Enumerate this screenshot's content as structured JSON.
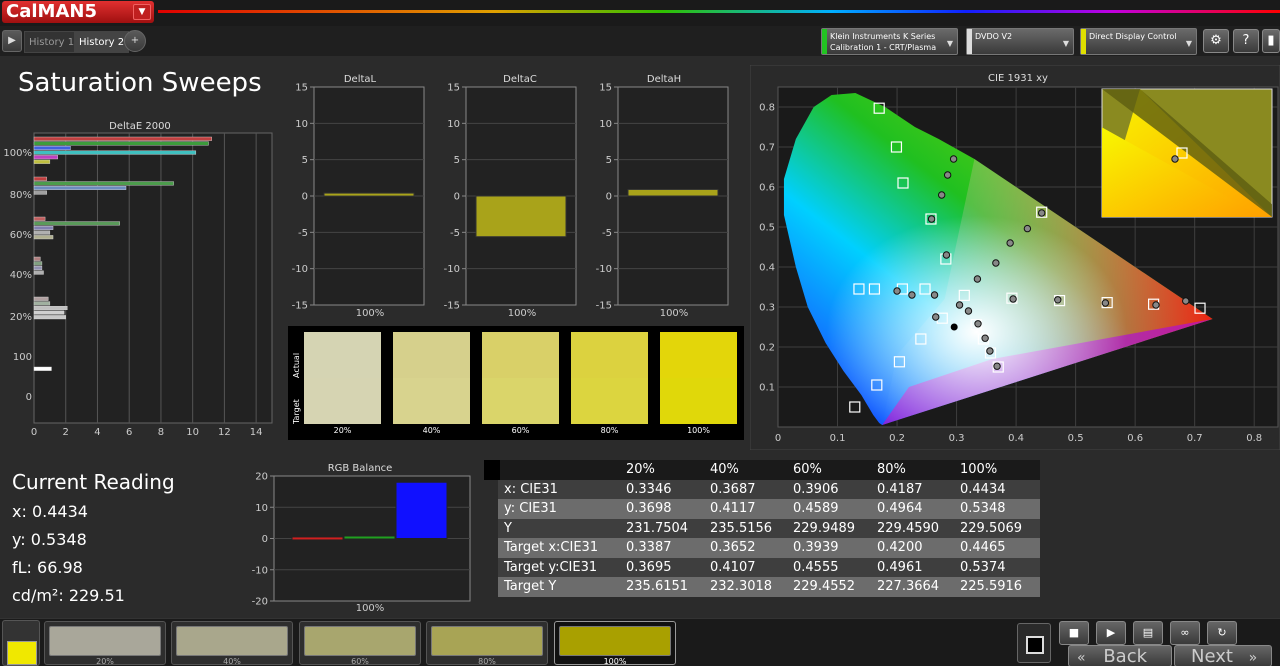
{
  "app": {
    "logo": "CalMAN",
    "logo_version": "5",
    "logo_menu_icon": "caret-down-icon"
  },
  "tabs": {
    "history1": "History 1",
    "history2": "History 2",
    "add_icon": "plus-icon",
    "play_icon": "play-icon"
  },
  "devices": [
    {
      "line1": "Klein Instruments K Series",
      "line2": "Calibration 1 - CRT/Plasma",
      "color": "#22c422"
    },
    {
      "line1": "DVDO V2",
      "line2": "",
      "color": "#dddddd"
    },
    {
      "line1": "Direct Display Control",
      "line2": "",
      "color": "#e0e000"
    }
  ],
  "toolbar_icons": [
    "gear-icon",
    "help-icon",
    "tool-icon"
  ],
  "page": {
    "title": "Saturation Sweeps"
  },
  "charts": {
    "deltae": {
      "title": "DeltaE 2000"
    },
    "deltal": {
      "title": "DeltaL",
      "category": "100%"
    },
    "deltac": {
      "title": "DeltaC",
      "category": "100%"
    },
    "deltah": {
      "title": "DeltaH",
      "category": "100%"
    },
    "cie": {
      "title": "CIE 1931 xy"
    },
    "rgb": {
      "title": "RGB Balance",
      "category": "100%"
    }
  },
  "chart_data": [
    {
      "type": "bar",
      "title": "DeltaE 2000",
      "orientation": "horizontal",
      "xlim": [
        0,
        15
      ],
      "x_ticks": [
        "0",
        "2",
        "4",
        "6",
        "8",
        "10",
        "12",
        "14"
      ],
      "y_ticks": [
        "100%",
        "80%",
        "60%",
        "40%",
        "20%",
        "100",
        "0"
      ],
      "groups": [
        {
          "name": "100%",
          "bars": [
            {
              "v": 11.2,
              "c": "#c04040"
            },
            {
              "v": 11.0,
              "c": "#3c9c3c"
            },
            {
              "v": 2.3,
              "c": "#4060e0"
            },
            {
              "v": 10.2,
              "c": "#40c0c0"
            },
            {
              "v": 1.5,
              "c": "#c040c0"
            },
            {
              "v": 1.0,
              "c": "#c0c040"
            }
          ]
        },
        {
          "name": "80%",
          "bars": [
            {
              "v": 0.8,
              "c": "#c04040"
            },
            {
              "v": 8.8,
              "c": "#4c9c4c"
            },
            {
              "v": 5.8,
              "c": "#6c8cc0"
            },
            {
              "v": 0.8,
              "c": "#a0a0a0"
            }
          ]
        },
        {
          "name": "60%",
          "bars": [
            {
              "v": 0.7,
              "c": "#c06060"
            },
            {
              "v": 5.4,
              "c": "#5a9a5a"
            },
            {
              "v": 1.2,
              "c": "#8080b0"
            },
            {
              "v": 1.0,
              "c": "#b0b0b0"
            },
            {
              "v": 1.2,
              "c": "#b0b090"
            }
          ]
        },
        {
          "name": "40%",
          "bars": [
            {
              "v": 0.4,
              "c": "#b08080"
            },
            {
              "v": 0.5,
              "c": "#80a080"
            },
            {
              "v": 0.5,
              "c": "#9090b0"
            },
            {
              "v": 0.6,
              "c": "#b0b0b0"
            }
          ]
        },
        {
          "name": "20%",
          "bars": [
            {
              "v": 0.9,
              "c": "#b0a0a0"
            },
            {
              "v": 1.0,
              "c": "#a0b0a0"
            },
            {
              "v": 2.1,
              "c": "#c0c0c0"
            },
            {
              "v": 1.9,
              "c": "#d0d0d0"
            },
            {
              "v": 2.0,
              "c": "#c8c8c8"
            }
          ]
        },
        {
          "name": "0",
          "bars": [
            {
              "v": 1.1,
              "c": "#ffffff"
            }
          ]
        }
      ]
    },
    {
      "type": "bar",
      "title": "DeltaL",
      "categories": [
        "100%"
      ],
      "values": [
        0.4
      ],
      "ylim": [
        -15,
        15
      ],
      "y_ticks": [
        15,
        10,
        5,
        0,
        -5,
        -10,
        -15
      ],
      "color": "#a9a31a"
    },
    {
      "type": "bar",
      "title": "DeltaC",
      "categories": [
        "100%"
      ],
      "values": [
        -5.6
      ],
      "ylim": [
        -15,
        15
      ],
      "y_ticks": [
        15,
        10,
        5,
        0,
        -5,
        -10,
        -15
      ],
      "color": "#a9a31a"
    },
    {
      "type": "bar",
      "title": "DeltaH",
      "categories": [
        "100%"
      ],
      "values": [
        0.9
      ],
      "ylim": [
        -15,
        15
      ],
      "y_ticks": [
        15,
        10,
        5,
        0,
        -5,
        -10,
        -15
      ],
      "color": "#a9a31a"
    },
    {
      "type": "scatter",
      "title": "CIE 1931 xy",
      "xlim": [
        0,
        0.8
      ],
      "ylim": [
        0,
        0.85
      ],
      "x_ticks": [
        "0",
        "0.1",
        "0.2",
        "0.3",
        "0.4",
        "0.5",
        "0.6",
        "0.7",
        "0.8"
      ],
      "y_ticks": [
        "0.1",
        "0.2",
        "0.3",
        "0.4",
        "0.5",
        "0.6",
        "0.7",
        "0.8"
      ],
      "gamut": {
        "red": [
          0.64,
          0.33
        ],
        "green": [
          0.3,
          0.6
        ],
        "blue": [
          0.15,
          0.06
        ]
      },
      "targets": [
        [
          0.17,
          0.797
        ],
        [
          0.199,
          0.7
        ],
        [
          0.21,
          0.61
        ],
        [
          0.257,
          0.52
        ],
        [
          0.282,
          0.42
        ],
        [
          0.136,
          0.345
        ],
        [
          0.162,
          0.345
        ],
        [
          0.209,
          0.345
        ],
        [
          0.247,
          0.345
        ],
        [
          0.313,
          0.329
        ],
        [
          0.443,
          0.537
        ],
        [
          0.393,
          0.322
        ],
        [
          0.473,
          0.316
        ],
        [
          0.553,
          0.311
        ],
        [
          0.631,
          0.307
        ],
        [
          0.709,
          0.297
        ],
        [
          0.129,
          0.05
        ],
        [
          0.166,
          0.105
        ],
        [
          0.204,
          0.163
        ],
        [
          0.24,
          0.22
        ],
        [
          0.276,
          0.272
        ],
        [
          0.333,
          0.256
        ],
        [
          0.345,
          0.22
        ],
        [
          0.357,
          0.185
        ],
        [
          0.37,
          0.15
        ]
      ],
      "actuals": [
        [
          0.295,
          0.67
        ],
        [
          0.285,
          0.63
        ],
        [
          0.275,
          0.58
        ],
        [
          0.258,
          0.52
        ],
        [
          0.283,
          0.43
        ],
        [
          0.2,
          0.34
        ],
        [
          0.225,
          0.33
        ],
        [
          0.263,
          0.33
        ],
        [
          0.305,
          0.305
        ],
        [
          0.335,
          0.37
        ],
        [
          0.366,
          0.41
        ],
        [
          0.39,
          0.46
        ],
        [
          0.419,
          0.496
        ],
        [
          0.443,
          0.535
        ],
        [
          0.395,
          0.32
        ],
        [
          0.47,
          0.318
        ],
        [
          0.55,
          0.31
        ],
        [
          0.635,
          0.305
        ],
        [
          0.685,
          0.315
        ],
        [
          0.265,
          0.275
        ],
        [
          0.32,
          0.29
        ],
        [
          0.336,
          0.258
        ],
        [
          0.348,
          0.222
        ],
        [
          0.356,
          0.19
        ],
        [
          0.368,
          0.152
        ]
      ],
      "white_point": [
        0.296,
        0.25
      ],
      "inset": {
        "target": [
          0.4465,
          0.5374
        ],
        "actual": [
          0.4434,
          0.5348
        ]
      }
    },
    {
      "type": "bar",
      "title": "RGB Balance",
      "categories": [
        "100%"
      ],
      "series": [
        {
          "values": [
            0.5
          ],
          "color": "#d02020"
        },
        {
          "values": [
            0.8
          ],
          "color": "#20a020"
        },
        {
          "values": [
            18.0
          ],
          "color": "#1010ff"
        }
      ],
      "ylim": [
        -20,
        20
      ],
      "y_ticks": [
        20,
        10,
        0,
        -10,
        -20
      ]
    },
    {
      "type": "table",
      "columns": [
        "",
        "20%",
        "40%",
        "60%",
        "80%",
        "100%"
      ],
      "rows": [
        [
          "x: CIE31",
          "0.3346",
          "0.3687",
          "0.3906",
          "0.4187",
          "0.4434"
        ],
        [
          "y: CIE31",
          "0.3698",
          "0.4117",
          "0.4589",
          "0.4964",
          "0.5348"
        ],
        [
          "Y",
          "231.7504",
          "235.5156",
          "229.9489",
          "229.4590",
          "229.5069"
        ],
        [
          "Target x:CIE31",
          "0.3387",
          "0.3652",
          "0.3939",
          "0.4200",
          "0.4465"
        ],
        [
          "Target y:CIE31",
          "0.3695",
          "0.4107",
          "0.4555",
          "0.4961",
          "0.5374"
        ],
        [
          "Target Y",
          "235.6151",
          "232.3018",
          "229.4552",
          "227.3664",
          "225.5916"
        ]
      ]
    }
  ],
  "swatches": {
    "actual_label": "Actual",
    "target_label": "Target",
    "items": [
      {
        "label": "20%",
        "actual": "#d5d4b3",
        "target": "#d6d4b2"
      },
      {
        "label": "40%",
        "actual": "#d6d08c",
        "target": "#d8d38e"
      },
      {
        "label": "60%",
        "actual": "#d9d068",
        "target": "#dad56a"
      },
      {
        "label": "80%",
        "actual": "#dcd23f",
        "target": "#dcd53f"
      },
      {
        "label": "100%",
        "actual": "#e3d60a",
        "target": "#e0d80a"
      }
    ]
  },
  "reading": {
    "title": "Current Reading",
    "x": "x: 0.4434",
    "y": "y: 0.5348",
    "fl": "fL: 66.98",
    "cd": "cd/m²: 229.51"
  },
  "bottom": {
    "current_color": "#f0e800",
    "patches": [
      {
        "label": "20%",
        "color": "#a9a79a"
      },
      {
        "label": "40%",
        "color": "#a9a78c"
      },
      {
        "label": "60%",
        "color": "#a8a66e"
      },
      {
        "label": "80%",
        "color": "#a8a455"
      },
      {
        "label": "100%",
        "color": "#a9a000",
        "selected": true
      }
    ],
    "controls": [
      "stop-icon",
      "play-icon",
      "save-icon",
      "loop-icon",
      "refresh-icon"
    ],
    "back": "Back",
    "next": "Next",
    "back_icon": "double-chevron-left-icon",
    "next_icon": "double-chevron-right-icon",
    "stop_big_icon": "stop-square-icon"
  }
}
